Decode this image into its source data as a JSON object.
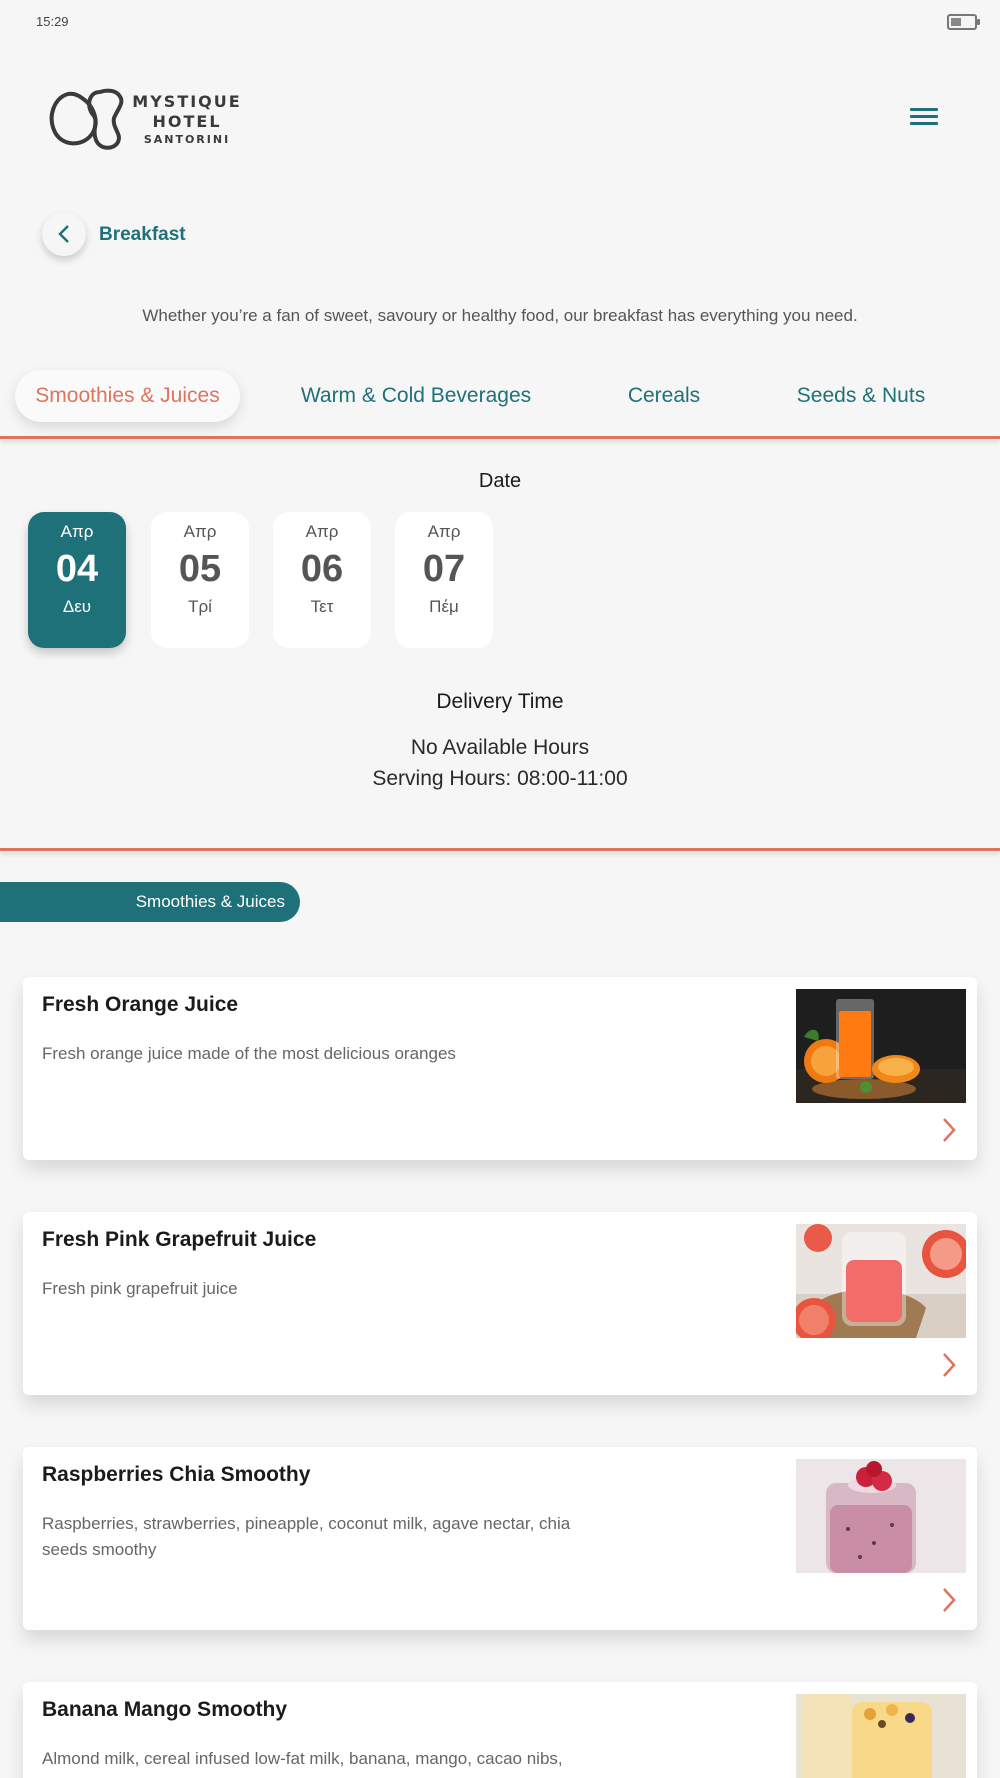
{
  "status_bar": {
    "time": "15:29",
    "battery_level": 0.45
  },
  "logo": {
    "line1": "MYSTIQUE",
    "line2": "HOTEL",
    "line3": "SANTORINI"
  },
  "header": {
    "menu_icon": "hamburger-menu-icon"
  },
  "breadcrumb": {
    "back_icon": "chevron-left-icon",
    "label": "Breakfast"
  },
  "intro_text": "Whether you’re a fan of sweet, savoury or healthy food, our breakfast has everything you need.",
  "tabs": [
    {
      "label": "Smoothies & Juices",
      "active": true
    },
    {
      "label": "Warm & Cold Beverages",
      "active": false
    },
    {
      "label": "Cereals",
      "active": false
    },
    {
      "label": "Seeds & Nuts",
      "active": false
    }
  ],
  "date_section": {
    "title": "Date",
    "dates": [
      {
        "month": "Απρ",
        "day": "04",
        "weekday": "Δευ",
        "selected": true
      },
      {
        "month": "Απρ",
        "day": "05",
        "weekday": "Τρί",
        "selected": false
      },
      {
        "month": "Απρ",
        "day": "06",
        "weekday": "Τετ",
        "selected": false
      },
      {
        "month": "Απρ",
        "day": "07",
        "weekday": "Πέμ",
        "selected": false
      }
    ]
  },
  "delivery": {
    "title": "Delivery Time",
    "status": "No Available Hours",
    "serving_hours": "Serving Hours: 08:00-11:00"
  },
  "category": {
    "label": "Smoothies & Juices"
  },
  "products": [
    {
      "name": "Fresh Orange Juice",
      "description": "Fresh orange juice made of the most delicious oranges",
      "image": "orange-juice-photo"
    },
    {
      "name": "Fresh Pink Grapefruit Juice",
      "description": "Fresh pink grapefruit juice",
      "image": "grapefruit-juice-photo"
    },
    {
      "name": "Raspberries Chia Smoothy",
      "description": "Raspberries, strawberries, pineapple, coconut milk, agave nectar, chia seeds smoothy",
      "image": "raspberry-chia-smoothy-photo"
    },
    {
      "name": "Banana Mango Smoothy",
      "description": "Almond milk, cereal infused low-fat milk, banana, mango, cacao nibs,",
      "image": "banana-mango-smoothy-photo"
    }
  ],
  "colors": {
    "accent": "#e0735e",
    "brand": "#1f7179",
    "background": "#f6f6f6"
  }
}
